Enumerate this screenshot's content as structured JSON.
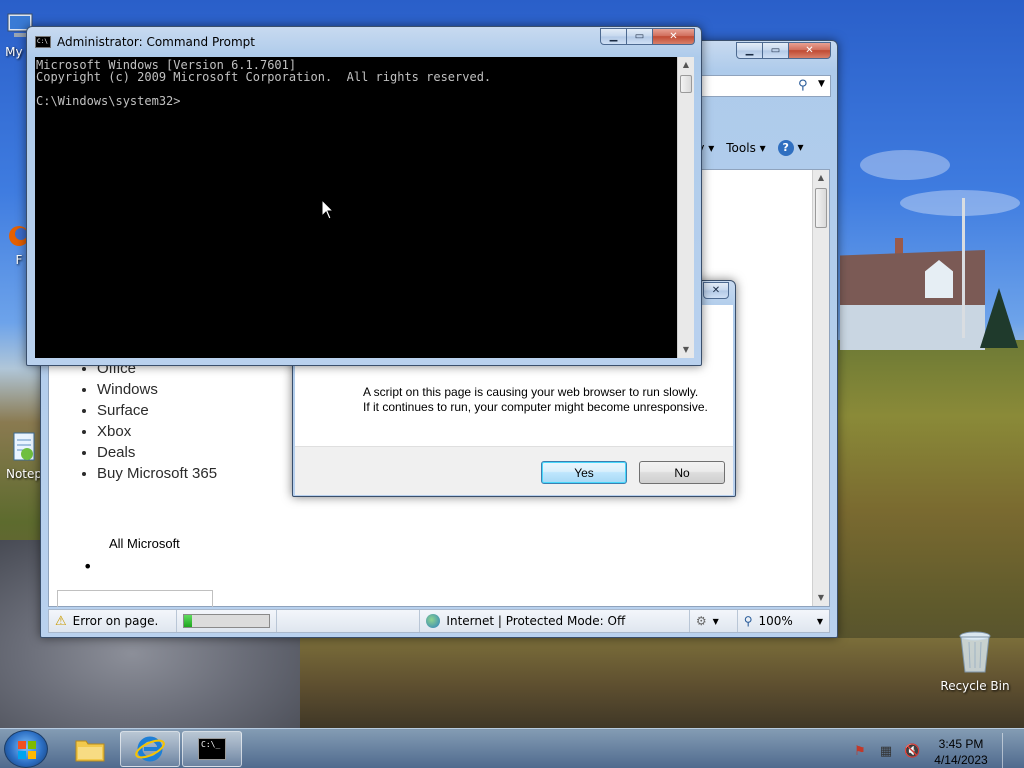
{
  "desktop": {
    "icons": [
      {
        "label": "My C",
        "icon": "computer-icon"
      },
      {
        "label": "F",
        "icon": "firefox-icon"
      },
      {
        "label": "Notep",
        "icon": "notepad-icon"
      },
      {
        "label": "Recycle Bin",
        "icon": "recycle-bin-icon"
      }
    ]
  },
  "cmd": {
    "title": "Administrator: Command Prompt",
    "lines": [
      "Microsoft Windows [Version 6.1.7601]",
      "Copyright (c) 2009 Microsoft Corporation.  All rights reserved.",
      "",
      "C:\\Windows\\system32>"
    ]
  },
  "ie": {
    "toolbar": {
      "safety": "fety",
      "tools": "Tools"
    },
    "page_menu": [
      "Office",
      "Windows",
      "Surface",
      "Xbox",
      "Deals",
      "Buy Microsoft 365"
    ],
    "all_microsoft": "All Microsoft",
    "status": {
      "error": "Error on page.",
      "progress_fraction": 0.1,
      "zone": "Internet | Protected Mode: Off",
      "zoom": "100%"
    }
  },
  "dialog": {
    "message_partial": "A script on this page is causing your web browser to run slowly.",
    "message_rest": "If it continues to run, your computer might become unresponsive.",
    "yes_label": "Yes",
    "no_label": "No"
  },
  "taskbar": {
    "time": "3:45 PM",
    "date": "4/14/2023"
  }
}
